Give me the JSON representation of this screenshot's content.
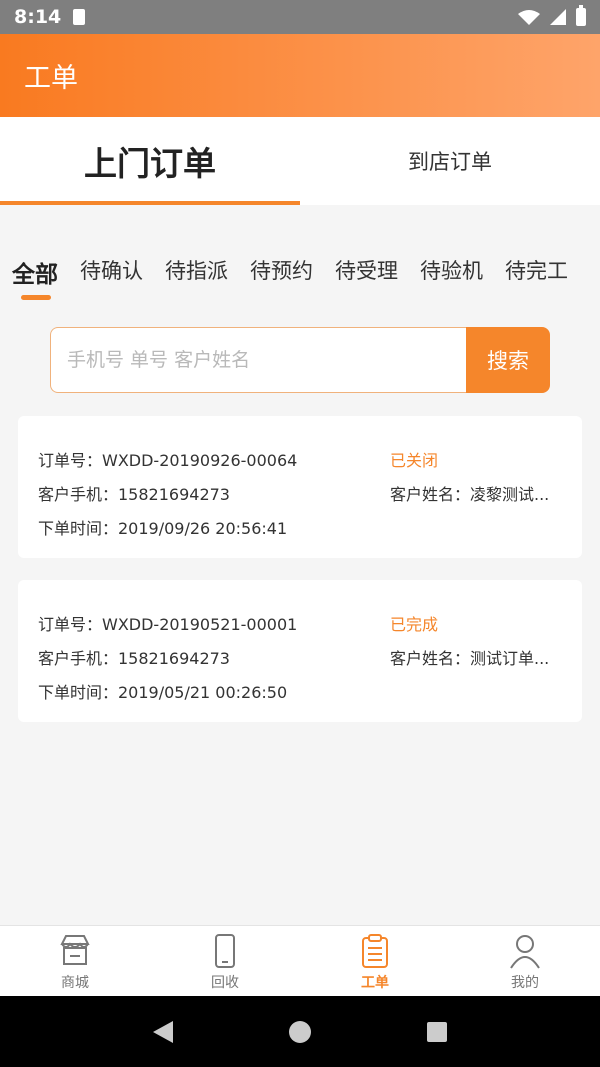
{
  "status_bar": {
    "time": "8:14"
  },
  "header": {
    "title": "工单"
  },
  "top_tabs": [
    {
      "label": "上门订单",
      "active": true
    },
    {
      "label": "到店订单",
      "active": false
    }
  ],
  "filter_tabs": [
    "全部",
    "待确认",
    "待指派",
    "待预约",
    "待受理",
    "待验机",
    "待完工"
  ],
  "search": {
    "placeholder": "手机号 单号 客户姓名",
    "button_label": "搜索"
  },
  "orders": [
    {
      "order_no": "订单号：WXDD-20190926-00064",
      "status": "已关闭",
      "phone": "客户手机：15821694273",
      "customer": "客户姓名：凌黎测试...",
      "time": "下单时间：2019/09/26 20:56:41"
    },
    {
      "order_no": "订单号：WXDD-20190521-00001",
      "status": "已完成",
      "phone": "客户手机：15821694273",
      "customer": "客户姓名：测试订单...",
      "time": "下单时间：2019/05/21 00:26:50"
    }
  ],
  "bottom_nav": [
    {
      "label": "商城",
      "icon": "store-icon"
    },
    {
      "label": "回收",
      "icon": "phone-icon"
    },
    {
      "label": "工单",
      "icon": "clipboard-icon"
    },
    {
      "label": "我的",
      "icon": "user-icon"
    }
  ],
  "colors": {
    "accent": "#f5862b",
    "header_start": "#f97a20",
    "header_end": "#fea46a"
  }
}
